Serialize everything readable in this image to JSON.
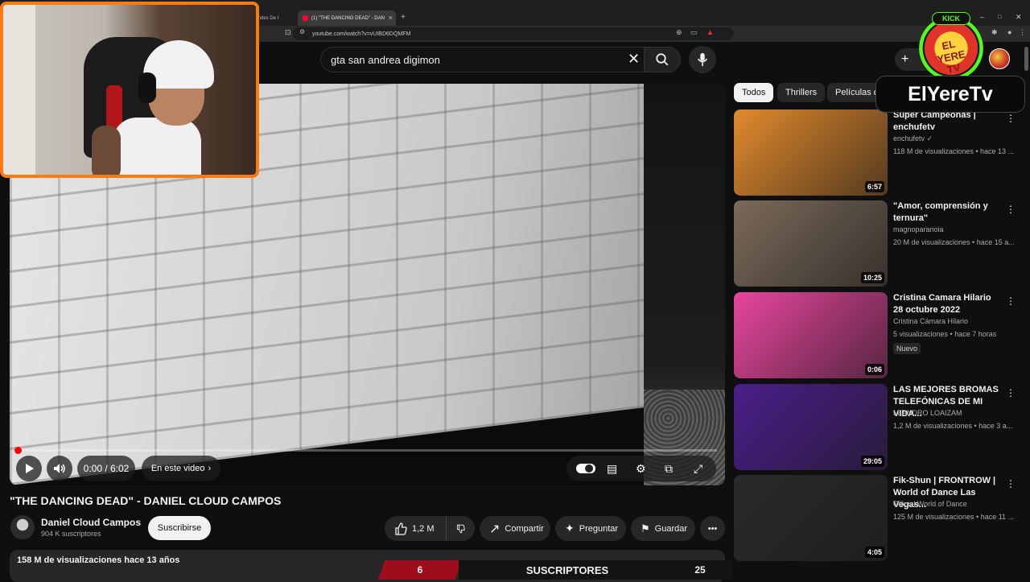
{
  "browser": {
    "tabs": [
      {
        "label": "s Grandes De I"
      },
      {
        "label": "(1) \"THE DANCING DEAD\" - DAN"
      }
    ],
    "new_tab": "+",
    "url": "youtube.com/watch?v=vUIBD6DQMFM",
    "window_controls": [
      "–",
      "□",
      "✕"
    ]
  },
  "header": {
    "search_value": "gta san andrea digimon",
    "clear_icon": "close-icon",
    "search_icon": "search-icon",
    "mic_icon": "mic-icon",
    "create_label": "+"
  },
  "player": {
    "time": "0:00 / 6:02",
    "chapter_label": "En este video",
    "progress_fraction": 0.0
  },
  "video": {
    "title": "\"THE DANCING DEAD\" - DANIEL CLOUD CAMPOS",
    "channel": "Daniel Cloud Campos",
    "subscribers": "904 K suscriptores",
    "subscribe_label": "Suscribirse",
    "likes": "1,2 M",
    "share_label": "Compartir",
    "ask_label": "Preguntar",
    "save_label": "Guardar",
    "views_line": "158 M de visualizaciones  hace 13 años"
  },
  "chips": [
    "Todos",
    "Thrillers",
    "Películas d"
  ],
  "overlay": {
    "kick_label": "KICK",
    "logo_text": "EL YERE TV",
    "streamer_name": "ElYereTv",
    "subbar_left": "6",
    "subbar_mid": "SUSCRIPTORES",
    "subbar_right": "25"
  },
  "related": [
    {
      "title": "Super Campeonas | enchufetv",
      "channel": "enchufetv ✓",
      "meta": "118 M de visualizaciones • hace 13 ...",
      "duration": "6:57",
      "badge": "",
      "thumb_color": "#e28a2c"
    },
    {
      "title": "\"Amor, comprensión y ternura\"",
      "channel": "magnoparanoia",
      "meta": "20 M de visualizaciones • hace 15 a...",
      "duration": "10:25",
      "badge": "",
      "thumb_color": "#7b6a5a"
    },
    {
      "title": "Cristina Camara Hilario 28 octubre 2022",
      "channel": "Cristina Cámara Hilario",
      "meta": "5 visualizaciones • hace 7 horas",
      "duration": "0:06",
      "badge": "Nuevo",
      "thumb_color": "#e8459e"
    },
    {
      "title": "LAS MEJORES BROMAS TELEFÓNICAS DE MI VIDA...",
      "channel": "LEANDRO LOAIZAM",
      "meta": "1,2 M de visualizaciones • hace 3 a...",
      "duration": "29:05",
      "badge": "",
      "thumb_color": "#4b1e8a"
    },
    {
      "title": "Fik-Shun | FRONTROW | World of Dance Las Vegas...",
      "channel": "Official World of Dance",
      "meta": "125 M de visualizaciones • hace 11 ...",
      "duration": "4:05",
      "badge": "",
      "thumb_color": "#2a2a2a"
    }
  ]
}
